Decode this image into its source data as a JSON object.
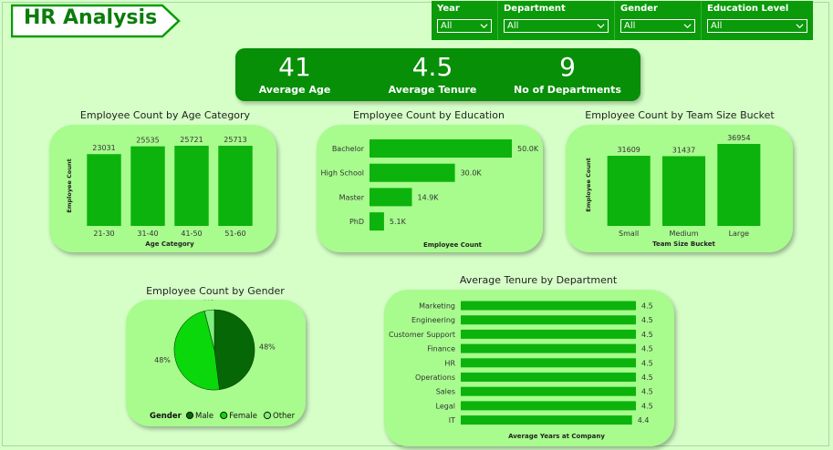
{
  "header": {
    "title": "HR Analysis"
  },
  "filters": [
    {
      "label": "Year",
      "value": "All"
    },
    {
      "label": "Department",
      "value": "All"
    },
    {
      "label": "Gender",
      "value": "All"
    },
    {
      "label": "Education Level",
      "value": "All"
    }
  ],
  "kpis": [
    {
      "value": "41",
      "label": "Average Age"
    },
    {
      "value": "4.5",
      "label": "Average Tenure"
    },
    {
      "value": "9",
      "label": "No of Departments"
    }
  ],
  "colors": {
    "bar": "#0cb30c",
    "male": "#056705",
    "female": "#0ad80a",
    "other": "#7cf07c",
    "kpi": "#078f07",
    "card": "#a8fc8e"
  },
  "chart_data": [
    {
      "id": "age",
      "type": "bar",
      "title": "Employee Count by Age Category",
      "categories": [
        "21-30",
        "31-40",
        "41-50",
        "51-60"
      ],
      "values": [
        23031,
        25535,
        25721,
        25713
      ],
      "data_labels": [
        "23031",
        "25535",
        "25721",
        "25713"
      ],
      "xlabel": "Age Category",
      "ylabel": "Employee Count",
      "ylim": [
        0,
        25721
      ]
    },
    {
      "id": "education",
      "type": "bar",
      "orientation": "horizontal",
      "title": "Employee Count by Education",
      "categories": [
        "Bachelor",
        "High School",
        "Master",
        "PhD"
      ],
      "values": [
        50000,
        30000,
        14900,
        5100
      ],
      "data_labels": [
        "50.0K",
        "30.0K",
        "14.9K",
        "5.1K"
      ],
      "xlabel": "Employee Count",
      "ylabel": "",
      "xlim": [
        0,
        50000
      ]
    },
    {
      "id": "team",
      "type": "bar",
      "title": "Employee Count by Team Size Bucket",
      "categories": [
        "Small",
        "Medium",
        "Large"
      ],
      "values": [
        31609,
        31437,
        36954
      ],
      "data_labels": [
        "31609",
        "31437",
        "36954"
      ],
      "xlabel": "Team Size Bucket",
      "ylabel": "Employee Count",
      "ylim": [
        0,
        36954
      ]
    },
    {
      "id": "gender",
      "type": "pie",
      "title": "Employee Count by Gender",
      "categories": [
        "Male",
        "Female",
        "Other"
      ],
      "values": [
        48,
        48,
        4
      ],
      "data_labels": [
        "48%",
        "48%",
        "4%"
      ],
      "legend_title": "Gender",
      "legend_position": "bottom"
    },
    {
      "id": "tenure",
      "type": "bar",
      "orientation": "horizontal",
      "title": "Average Tenure by Department",
      "categories": [
        "Marketing",
        "Engineering",
        "Customer Support",
        "Finance",
        "HR",
        "Operations",
        "Sales",
        "Legal",
        "IT"
      ],
      "values": [
        4.5,
        4.5,
        4.5,
        4.5,
        4.5,
        4.5,
        4.5,
        4.5,
        4.4
      ],
      "data_labels": [
        "4.5",
        "4.5",
        "4.5",
        "4.5",
        "4.5",
        "4.5",
        "4.5",
        "4.5",
        "4.4"
      ],
      "xlabel": "Average Years at Company",
      "ylabel": "",
      "xlim": [
        0,
        4.5
      ]
    }
  ]
}
